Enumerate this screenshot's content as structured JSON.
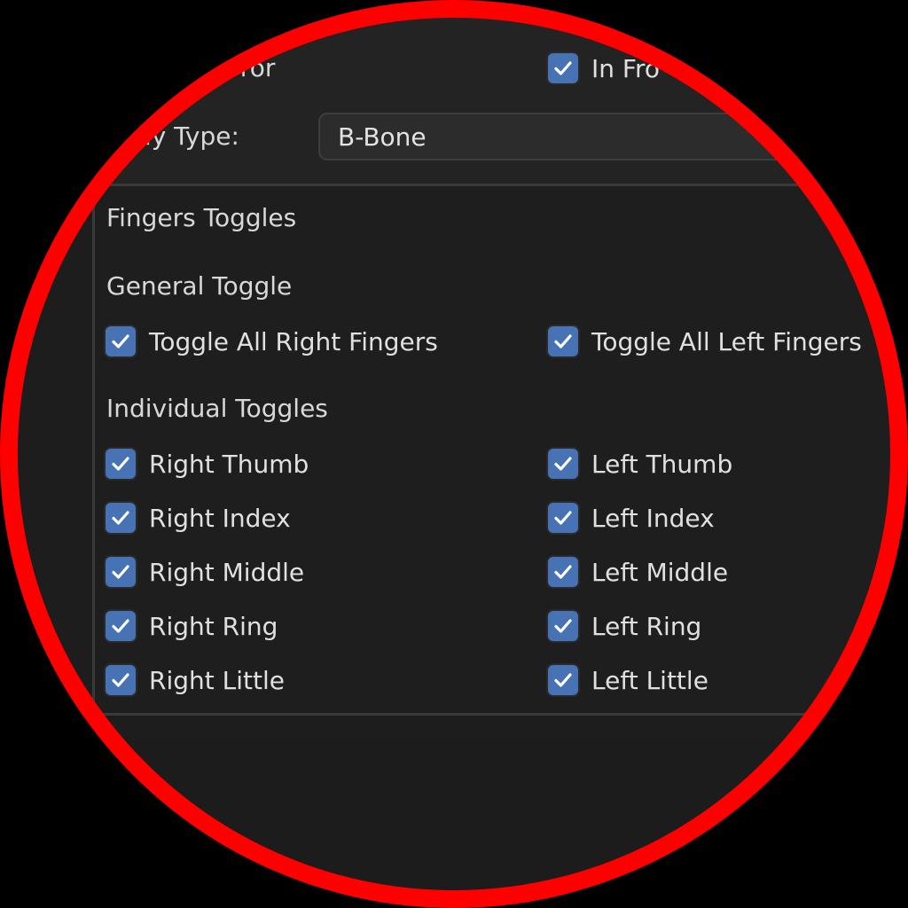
{
  "display": {
    "mirror_label": "irror",
    "in_front_label": "In Fro",
    "display_type_label": "play Type:",
    "display_type_value": "B-Bone"
  },
  "panel": {
    "title": "Fingers Toggles",
    "general_heading": "General Toggle",
    "toggle_all_right": "Toggle All Right Fingers",
    "toggle_all_left": "Toggle All Left Fingers",
    "individual_heading": "Individual Toggles",
    "right": [
      "Right Thumb",
      "Right Index",
      "Right Middle",
      "Right Ring",
      "Right Little"
    ],
    "left": [
      "Left Thumb",
      "Left Index",
      "Left Middle",
      "Left Ring",
      "Left Little"
    ]
  },
  "colors": {
    "checkbox": "#4772b3",
    "highlight_ring": "#ff0000"
  }
}
